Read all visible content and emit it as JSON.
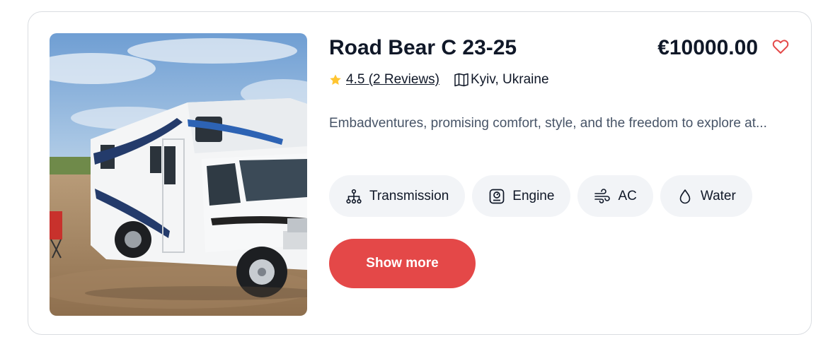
{
  "listing": {
    "title": "Road Bear C 23-25",
    "price": "€10000.00",
    "rating_text": "4.5 (2 Reviews)",
    "location": "Kyiv, Ukraine",
    "description": "Embadventures, promising comfort, style, and the freedom to explore at...",
    "image_alt": "Camper van parked on dirt ground",
    "features": [
      {
        "label": "Transmission",
        "icon": "transmission-icon"
      },
      {
        "label": "Engine",
        "icon": "engine-icon"
      },
      {
        "label": "AC",
        "icon": "wind-icon"
      },
      {
        "label": "Water",
        "icon": "water-drop-icon"
      }
    ],
    "show_more_label": "Show more"
  },
  "colors": {
    "accent": "#e44848",
    "star": "#ffc531",
    "chip_bg": "#f2f4f7",
    "text": "#101828",
    "muted": "#475467"
  }
}
